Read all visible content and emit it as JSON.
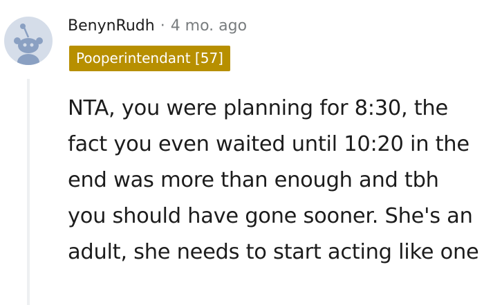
{
  "comment": {
    "author": "BenynRudh",
    "separator": "·",
    "timestamp": "4 mo. ago",
    "flair": "Pooperintendant [57]",
    "body": "NTA, you were planning for 8:30, the fact you even waited until 10:20 in the end was more than enough and tbh you should have gone sooner. She's an adult, she needs to start acting like one",
    "avatar_icon": "snoo-avatar-icon"
  },
  "colors": {
    "flair_bg": "#b78f00",
    "flair_text": "#ffffff",
    "avatar_bg": "#d5dde9",
    "avatar_fg": "#8aa0c2",
    "meta_text": "#787c7e",
    "body_text": "#1c1c1c",
    "thread_line": "#eef0f2"
  }
}
